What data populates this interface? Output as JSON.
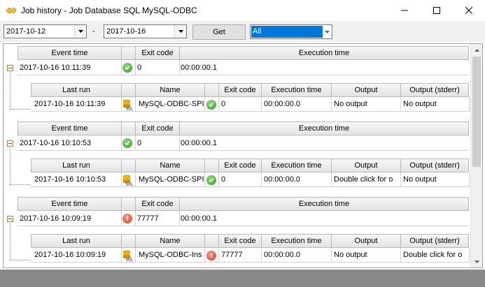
{
  "window": {
    "title": "Job history - Job Database SQL MySQL-ODBC"
  },
  "toolbar": {
    "date_from": "2017-10-12",
    "separator": "-",
    "date_to": "2017-10-16",
    "get_label": "Get",
    "filter_value": "All"
  },
  "master_headers": {
    "event_time": "Event time",
    "exit_code": "Exit code",
    "execution_time": "Execution time"
  },
  "detail_headers": {
    "last_run": "Last run",
    "name": "Name",
    "exit_code": "Exit code",
    "execution_time": "Execution time",
    "output": "Output",
    "output_stderr": "Output (stderr)"
  },
  "groups": [
    {
      "event_time": "2017-10-16 10:11:39",
      "status": "success",
      "exit_code": "0",
      "execution_time": "00:00:00.1",
      "detail": {
        "last_run": "2017-10-16 10:11:39",
        "name": "MySQL-ODBC-SPI",
        "status": "success",
        "exit_code": "0",
        "execution_time": "00:00:00.0",
        "output": "No output",
        "output_stderr": "No output"
      }
    },
    {
      "event_time": "2017-10-16 10:10:53",
      "status": "success",
      "exit_code": "0",
      "execution_time": "00:00:00.1",
      "detail": {
        "last_run": "2017-10-16 10:10:53",
        "name": "MySQL-ODBC-SPI",
        "status": "success",
        "exit_code": "0",
        "execution_time": "00:00:00.0",
        "output": "Double click for o",
        "output_stderr": "No output"
      }
    },
    {
      "event_time": "2017-10-16 10:09:19",
      "status": "error",
      "exit_code": "77777",
      "execution_time": "00:00:00.1",
      "detail": {
        "last_run": "2017-10-16 10:09:19",
        "name": "MySQL-ODBC-Ins",
        "status": "error",
        "exit_code": "77777",
        "execution_time": "00:00:00.0",
        "output": "No output",
        "output_stderr": "Double click for o"
      }
    }
  ],
  "icons": {
    "success": "check-circle-icon",
    "error": "exclamation-circle-icon",
    "job": "sql-database-icon"
  },
  "colors": {
    "selection": "#0078d7",
    "success": "#2f9a25",
    "error": "#d43a22",
    "statusbar": "#8a8a8a"
  }
}
